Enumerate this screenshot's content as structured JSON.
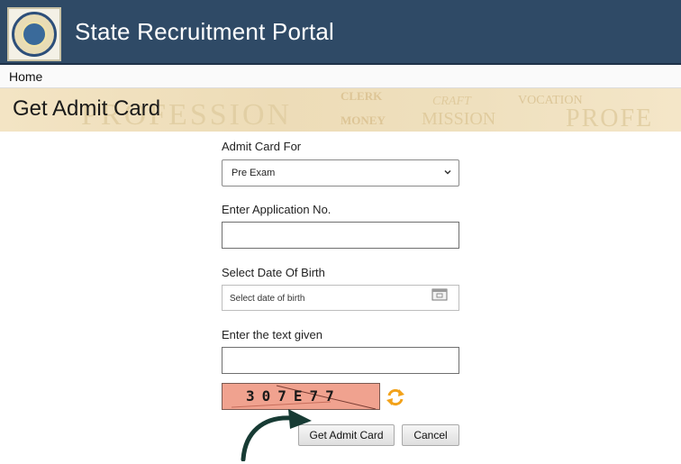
{
  "header": {
    "title": "State Recruitment Portal",
    "logo_icon": "state-emblem-icon",
    "color": "#2f4a66"
  },
  "nav": {
    "home": "Home"
  },
  "page": {
    "title": "Get Admit Card",
    "banner_words": [
      "PROFESSION",
      "CLERK",
      "MONEY",
      "MISSION",
      "CRAFT",
      "VOCATION",
      "PROFE"
    ]
  },
  "form": {
    "admit_card_for": {
      "label": "Admit Card For",
      "selected": "Pre Exam"
    },
    "application_no": {
      "label": "Enter Application No.",
      "value": ""
    },
    "dob": {
      "label": "Select Date Of Birth",
      "placeholder": "Select date of birth"
    },
    "captcha": {
      "label": "Enter the text given",
      "value": "",
      "code": "307E77"
    }
  },
  "buttons": {
    "submit": "Get Admit Card",
    "cancel": "Cancel"
  }
}
